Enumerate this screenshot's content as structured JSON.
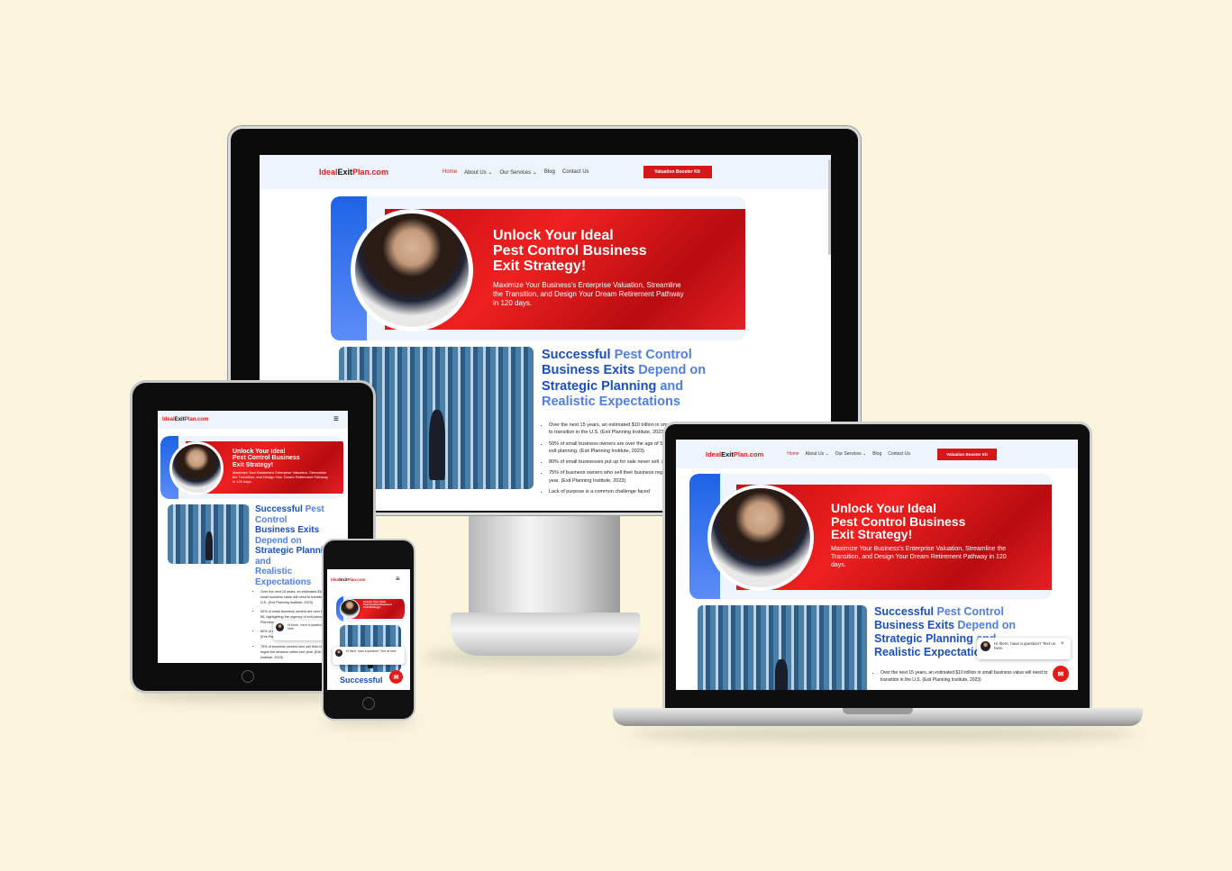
{
  "site": {
    "logo_left": "Ideal",
    "logo_mid": "Exit",
    "logo_right": "Plan.com",
    "nav": [
      "Home",
      "About Us",
      "Our Services",
      "Blog",
      "Contact Us"
    ],
    "cta": "Valuation Booster Kit",
    "hero_title_1": "Unlock Your Ideal",
    "hero_title_2": "Pest Control Business",
    "hero_title_3": "Exit Strategy!",
    "hero_sub": "Maximize Your Business's Enterprise Valuation, Streamline the Transition, and Design Your Dream Retirement Pathway in 120 days.",
    "section_title_a": "Successful ",
    "section_title_b": "Pest Control",
    "section_title_c": "Business Exits ",
    "section_title_d": "Depend on",
    "section_title_e": "Strategic Planning ",
    "section_title_f": "and",
    "section_title_g": "Realistic Expectations",
    "bullets": [
      "Over the next 15 years, an estimated $10 trillion in small business value will need to transition in the U.S. (Exit Planning Institute, 2023)",
      "50% of small business owners are over the age of 55, highlighting the urgency of exit planning. (Exit Planning Institute, 2023)",
      "80% of small businesses put up for sale never sell. (Exit Planning Institute, 2023)",
      "75% of business owners who sell their business regret the decision within one year. (Exit Planning Institute, 2023)",
      "Lack of purpose is a common challenge faced"
    ],
    "chat_text": "Hi there, have a question? Text us here.",
    "chat_close": "×",
    "chat_fab": "✉",
    "menu_icon": "≡"
  }
}
